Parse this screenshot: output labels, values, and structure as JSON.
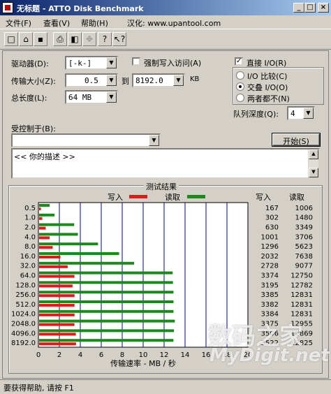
{
  "window": {
    "title": "无标题 - ATTO Disk Benchmark"
  },
  "menu": {
    "file": "文件(F)",
    "view": "查看(V)",
    "help": "帮助(H)",
    "localized": "汉化: www.upantool.com"
  },
  "toolbar": {
    "icons": [
      "new-icon",
      "open-icon",
      "save-icon",
      "print-icon",
      "print-preview-icon",
      "move-icon",
      "help-icon"
    ]
  },
  "settings": {
    "drive_label": "驱动器(D):",
    "drive_value": "[-k-]",
    "force_write_label": "强制写入访问(A)",
    "direct_io_label": "直接 I/O(R)",
    "transfer_label": "传输大小(Z):",
    "transfer_from": "0.5",
    "to_label": "到",
    "transfer_to": "8192.0",
    "kb": "KB",
    "total_label": "总长度(L):",
    "total_value": "64 MB",
    "io_compare": "I/O 比较(C)",
    "overlap_io": "交叠 I/O(O)",
    "neither": "两者都不(N)",
    "queue_label": "队列深度(Q):",
    "queue_value": "4",
    "controlled_label": "受控制于(B):",
    "controlled_value": "",
    "start_button": "开始(S)",
    "description": "<< 你的描述 >>"
  },
  "results": {
    "group_title": "测试结果",
    "write_legend": "写入",
    "read_legend": "读取",
    "write_color": "#e8161a",
    "read_color": "#1a8a1a",
    "col_write": "写入",
    "col_read": "读取"
  },
  "chart_data": {
    "type": "bar",
    "orientation": "horizontal",
    "categories": [
      "0.5",
      "1.0",
      "2.0",
      "4.0",
      "8.0",
      "16.0",
      "32.0",
      "64.0",
      "128.0",
      "256.0",
      "512.0",
      "1024.0",
      "2048.0",
      "4096.0",
      "8192.0"
    ],
    "series": [
      {
        "name": "写入",
        "values": [
          167,
          302,
          630,
          1001,
          1296,
          2032,
          2728,
          3374,
          3195,
          3385,
          3382,
          3384,
          3375,
          3506,
          3522
        ]
      },
      {
        "name": "读取",
        "values": [
          1006,
          1480,
          3349,
          3706,
          5623,
          7638,
          9077,
          12750,
          12782,
          12831,
          12831,
          12831,
          12955,
          12869,
          12825
        ]
      }
    ],
    "write_display": [
      "167",
      "302",
      "630",
      "1001",
      "1296",
      "2032",
      "2728",
      "3374",
      "3195",
      "3385",
      "3382",
      "3384",
      "3375",
      "3506",
      "3522"
    ],
    "read_display": [
      "1006",
      "1480",
      "3349",
      "3706",
      "5623",
      "7638",
      "9077",
      "12750",
      "12782",
      "12831",
      "12831",
      "12831",
      "12955",
      "12869",
      "12825"
    ],
    "xticks": [
      "0",
      "2",
      "4",
      "6",
      "8",
      "10",
      "12",
      "14",
      "16",
      "18",
      "20"
    ],
    "xlim": [
      0,
      20
    ],
    "xlabel": "传输速率 - MB / 秒"
  },
  "status": {
    "text": "要获得帮助, 请按 F1"
  },
  "watermark": {
    "cn": "数码之家",
    "en": "MyDigit.net"
  }
}
